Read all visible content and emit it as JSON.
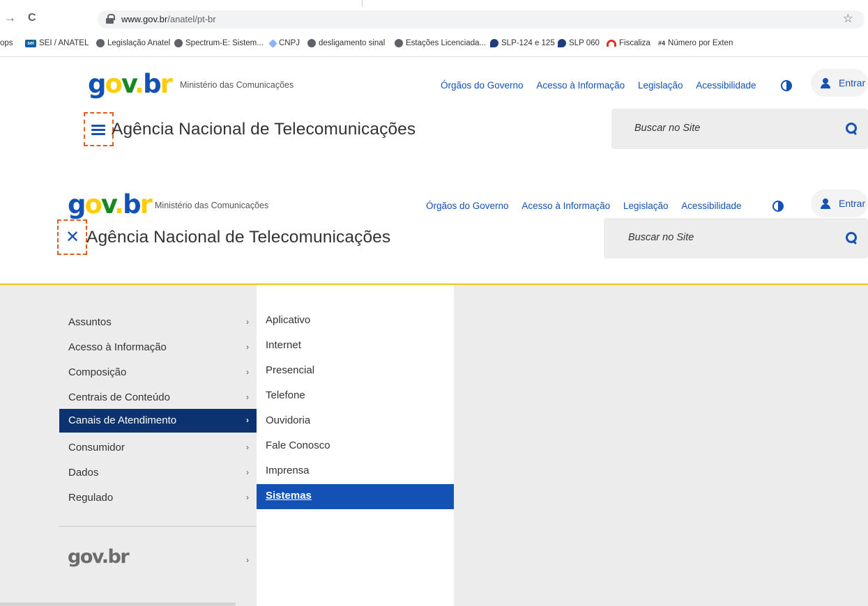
{
  "browser": {
    "back_icon": "→",
    "reload_icon": "C",
    "url_host": "www.gov.br",
    "url_path": "/anatel/pt-br",
    "star_icon": "☆",
    "bookmarks": [
      {
        "label": "ops",
        "icon": "none"
      },
      {
        "label": "SEI / ANATEL",
        "icon": "sei-icon",
        "icon_text": "sei"
      },
      {
        "label": "Legislação Anatel",
        "icon": "globe-icon"
      },
      {
        "label": "Spectrum-E: Sistem...",
        "icon": "globe-icon"
      },
      {
        "label": "CNPJ",
        "icon": "cnpj-icon"
      },
      {
        "label": "desligamento sinal",
        "icon": "globe-icon"
      },
      {
        "label": "Estações Licenciada...",
        "icon": "globe-icon"
      },
      {
        "label": "SLP-124 e 125",
        "icon": "slp-icon"
      },
      {
        "label": "SLP 060",
        "icon": "slp-icon"
      },
      {
        "label": "Fiscaliza",
        "icon": "fiscaliza-icon"
      },
      {
        "label": "Número por Exten",
        "icon": "numero-icon",
        "icon_text": "#4"
      }
    ]
  },
  "header": {
    "logo_text": "gov.br",
    "ministry": "Ministério das Comunicações",
    "top_links": [
      "Órgãos do Governo",
      "Acesso à Informação",
      "Legislação",
      "Acessibilidade"
    ],
    "login_label": "Entrar",
    "site_title": "Agência Nacional de Telecomunicações",
    "search_placeholder": "Buscar no Site",
    "close_icon": "✕"
  },
  "menu": {
    "primary": [
      {
        "label": "Assuntos",
        "active": false
      },
      {
        "label": "Acesso à Informação",
        "active": false
      },
      {
        "label": "Composição",
        "active": false
      },
      {
        "label": "Centrais de Conteúdo",
        "active": false
      },
      {
        "label": "Canais de Atendimento",
        "active": true
      },
      {
        "label": "Consumidor",
        "active": false
      },
      {
        "label": "Dados",
        "active": false
      },
      {
        "label": "Regulado",
        "active": false
      }
    ],
    "secondary": [
      {
        "label": "Aplicativo",
        "active": false
      },
      {
        "label": "Internet",
        "active": false
      },
      {
        "label": "Presencial",
        "active": false
      },
      {
        "label": "Telefone",
        "active": false
      },
      {
        "label": "Ouvidoria",
        "active": false
      },
      {
        "label": "Fale Conosco",
        "active": false
      },
      {
        "label": "Imprensa",
        "active": false
      },
      {
        "label": "Sistemas",
        "active": true
      }
    ],
    "chevron": "›",
    "footer_logo": "gov.br"
  },
  "colors": {
    "primary_blue": "#1351b4",
    "active_navy": "#0c326f",
    "accent_yellow": "#ffcd07",
    "green": "#168821",
    "highlight_dashed": "#e05e1e"
  }
}
